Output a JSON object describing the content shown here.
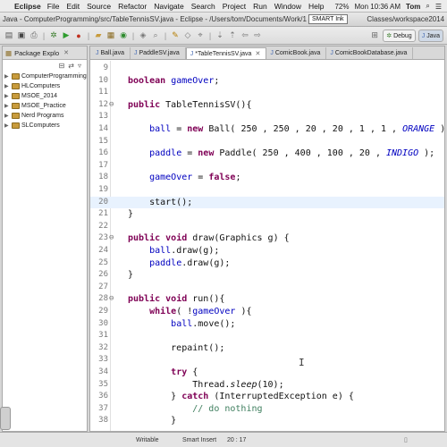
{
  "menubar": {
    "app": "Eclipse",
    "items": [
      "File",
      "Edit",
      "Source",
      "Refactor",
      "Navigate",
      "Search",
      "Project",
      "Run",
      "Window",
      "Help"
    ],
    "battery": "72%",
    "clock": "Mon 10:36 AM",
    "user": "Tom"
  },
  "window": {
    "title_left": "Java - ComputerProgramming/src/TableTennisSV.java - Eclipse - /Users/tom/Documents/Work/1 Teach",
    "title_right": "Classes/workspace2014",
    "tooltip": "SMART Ink"
  },
  "perspectives": {
    "debug": "Debug",
    "java": "Java"
  },
  "package_explorer": {
    "title": "Package Explo",
    "projects": [
      "ComputerProgramming",
      "HLComputers",
      "MSOE_2014",
      "MSOE_Practice",
      "Nerd Programs",
      "SLComputers"
    ]
  },
  "editor": {
    "tabs": [
      {
        "label": "Ball.java",
        "active": false
      },
      {
        "label": "PaddleSV.java",
        "active": false
      },
      {
        "label": "*TableTennisSV.java",
        "active": true
      },
      {
        "label": "ComicBook.java",
        "active": false
      },
      {
        "label": "ComicBookDatabase.java",
        "active": false
      }
    ],
    "lines": [
      {
        "n": "9",
        "marker": "",
        "html": ""
      },
      {
        "n": "10",
        "marker": "",
        "html": "<span class=\"kw\">boolean</span> <span class=\"fld\">gameOver</span>;"
      },
      {
        "n": "11",
        "marker": "",
        "html": ""
      },
      {
        "n": "12",
        "marker": "⊖",
        "html": "<span class=\"kw\">public</span> TableTennisSV(){"
      },
      {
        "n": "13",
        "marker": "",
        "html": ""
      },
      {
        "n": "14",
        "marker": "",
        "html": "    <span class=\"fld\">ball</span> = <span class=\"kw\">new</span> Ball( 250 , 250 , 20 , 20 , 1 , 1 , <span class=\"const\">ORANGE</span> );"
      },
      {
        "n": "15",
        "marker": "",
        "html": ""
      },
      {
        "n": "16",
        "marker": "",
        "html": "    <span class=\"fld\">paddle</span> = <span class=\"kw\">new</span> Paddle( 250 , 400 , 100 , 20 , <span class=\"const\">INDIGO</span> );"
      },
      {
        "n": "17",
        "marker": "",
        "html": ""
      },
      {
        "n": "18",
        "marker": "",
        "html": "    <span class=\"fld\">gameOver</span> = <span class=\"kw\">false</span>;"
      },
      {
        "n": "19",
        "marker": "",
        "html": ""
      },
      {
        "n": "20",
        "marker": "",
        "html": "    start();",
        "current": true
      },
      {
        "n": "21",
        "marker": "",
        "html": "}"
      },
      {
        "n": "22",
        "marker": "",
        "html": ""
      },
      {
        "n": "23",
        "marker": "⊖",
        "html": "<span class=\"kw\">public</span> <span class=\"kw\">void</span> draw(Graphics g) {"
      },
      {
        "n": "24",
        "marker": "",
        "html": "    <span class=\"fld\">ball</span>.draw(g);"
      },
      {
        "n": "25",
        "marker": "",
        "html": "    <span class=\"fld\">paddle</span>.draw(g);"
      },
      {
        "n": "26",
        "marker": "",
        "html": "}"
      },
      {
        "n": "27",
        "marker": "",
        "html": ""
      },
      {
        "n": "28",
        "marker": "⊖",
        "html": "<span class=\"kw\">public</span> <span class=\"kw\">void</span> run(){"
      },
      {
        "n": "29",
        "marker": "",
        "html": "    <span class=\"kw\">while</span>( !<span class=\"fld\">gameOver</span> ){"
      },
      {
        "n": "30",
        "marker": "",
        "html": "        <span class=\"fld\">ball</span>.move();"
      },
      {
        "n": "31",
        "marker": "",
        "html": ""
      },
      {
        "n": "32",
        "marker": "",
        "html": "        repaint();"
      },
      {
        "n": "33",
        "marker": "",
        "html": ""
      },
      {
        "n": "34",
        "marker": "",
        "html": "        <span class=\"kw\">try</span> {"
      },
      {
        "n": "35",
        "marker": "",
        "html": "            Thread.<span class=\"mth\">sleep</span>(10);"
      },
      {
        "n": "36",
        "marker": "",
        "html": "        } <span class=\"kw\">catch</span> (InterruptedException e) {"
      },
      {
        "n": "37",
        "marker": "",
        "html": "            <span class=\"cmt\">// do nothing</span>"
      },
      {
        "n": "38",
        "marker": "",
        "html": "        }"
      }
    ]
  },
  "status": {
    "writable": "Writable",
    "insert_mode": "Smart Insert",
    "position": "20 : 17"
  }
}
